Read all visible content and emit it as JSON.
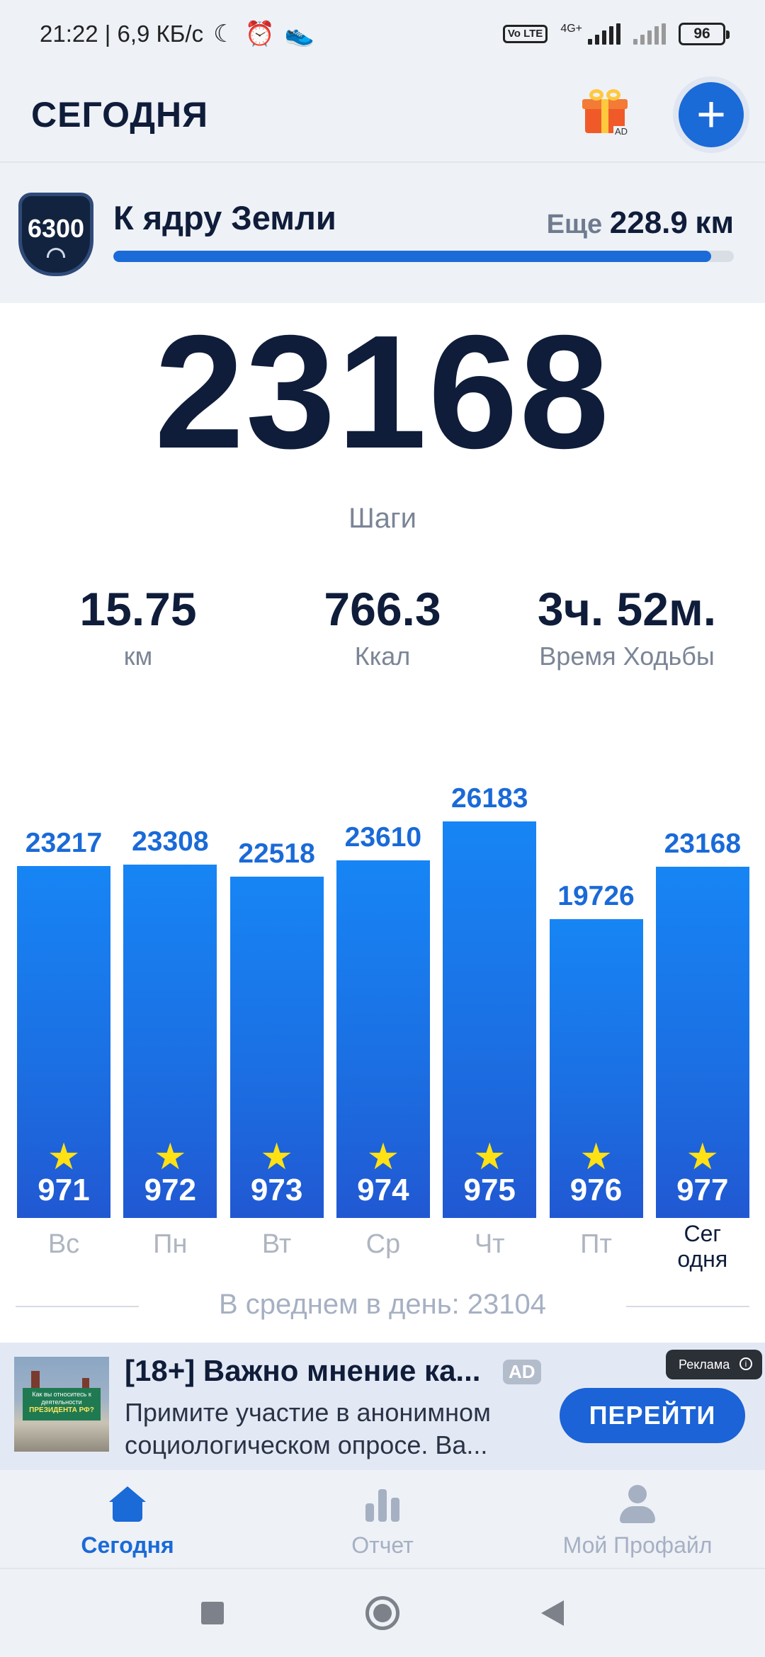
{
  "status_bar": {
    "time_speed": "21:22 | 6,9 КБ/с",
    "network": "4G+",
    "volte": "Vo LTE",
    "battery": "96"
  },
  "header": {
    "title": "СЕГОДНЯ",
    "gift_ad_label": "AD",
    "icons": [
      "gift-icon",
      "plus-icon"
    ]
  },
  "goal": {
    "badge_number": "6300",
    "name": "К ядру Земли",
    "remaining_prefix": "Еще",
    "remaining_value": "228.9",
    "remaining_unit": "км",
    "progress_fraction": 0.964
  },
  "today": {
    "steps": "23168",
    "steps_label": "Шаги",
    "stats": [
      {
        "value": "15.75",
        "label": "км"
      },
      {
        "value": "766.3",
        "label": "Ккал"
      },
      {
        "value": "3ч. 52м.",
        "label": "Время Ходьбы"
      }
    ]
  },
  "chart_data": {
    "type": "bar",
    "categories": [
      "Вс",
      "Пн",
      "Вт",
      "Ср",
      "Чт",
      "Пт",
      "Сег одня"
    ],
    "values": [
      23217,
      23308,
      22518,
      23610,
      26183,
      19726,
      23168
    ],
    "badges": [
      "971",
      "972",
      "973",
      "974",
      "975",
      "976",
      "977"
    ],
    "value_labels": [
      "23217",
      "23308",
      "22518",
      "23610",
      "26183",
      "19726",
      "23168"
    ],
    "today_label_lines": [
      "Сег",
      "одня"
    ],
    "bar_color": "#1b70e3",
    "star_color": "#ffe114",
    "badge_icon": "star-icon"
  },
  "average": {
    "text": "В среднем в день: 23104"
  },
  "ad": {
    "title": "[18+] Важно мнение ка...",
    "tag": "AD",
    "body_line1": "Примите участие в анонимном",
    "body_line2": "социологическом опросе. Ва...",
    "cta": "ПЕРЕЙТИ",
    "image_text_small": "Как вы относитесь к деятельности",
    "image_text_big": "ПРЕЗИДЕНТА РФ?",
    "corner_label": "Реклама"
  },
  "bottom_nav": {
    "items": [
      {
        "label": "Сегодня",
        "icon": "home-icon",
        "active": true
      },
      {
        "label": "Отчет",
        "icon": "bar-chart-icon",
        "active": false
      },
      {
        "label": "Мой Профайл",
        "icon": "profile-icon",
        "active": false
      }
    ]
  },
  "colors": {
    "accent": "#1a6ad8",
    "dark_text": "#0f1d3a",
    "muted_text": "#7b8596",
    "background": "#eef1f6"
  }
}
